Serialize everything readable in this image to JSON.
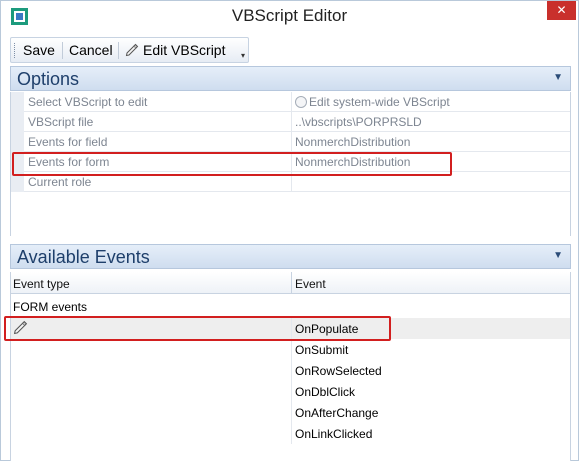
{
  "window": {
    "title": "VBScript Editor",
    "close_glyph": "✕",
    "icon": "vbscript-editor-app-icon"
  },
  "toolbar": {
    "save_label": "Save",
    "cancel_label": "Cancel",
    "edit_label": "Edit VBScript",
    "more_glyph": "▾",
    "edit_icon": "pencil-script-icon"
  },
  "options": {
    "header": "Options",
    "rows": [
      {
        "label": "Select VBScript to edit",
        "value": "Edit system-wide VBScript",
        "has_radio": true
      },
      {
        "label": "VBScript file",
        "value": "..\\vbscripts\\PORPRSLD"
      },
      {
        "label": "Events for field",
        "value": "NonmerchDistribution"
      },
      {
        "label": "Events for form",
        "value": "NonmerchDistribution"
      },
      {
        "label": "Current role",
        "value": ""
      }
    ]
  },
  "events": {
    "header": "Available Events",
    "columns": [
      "Event type",
      "Event"
    ],
    "group": "FORM events",
    "rows": [
      {
        "event": "OnPopulate",
        "selected": true
      },
      {
        "event": "OnSubmit"
      },
      {
        "event": "OnRowSelected"
      },
      {
        "event": "OnDblClick"
      },
      {
        "event": "OnAfterChange"
      },
      {
        "event": "OnLinkClicked"
      }
    ]
  },
  "colors": {
    "accent_header": "#1e3f6b",
    "highlight_box": "#d21f1f",
    "close_button": "#c9302c"
  }
}
